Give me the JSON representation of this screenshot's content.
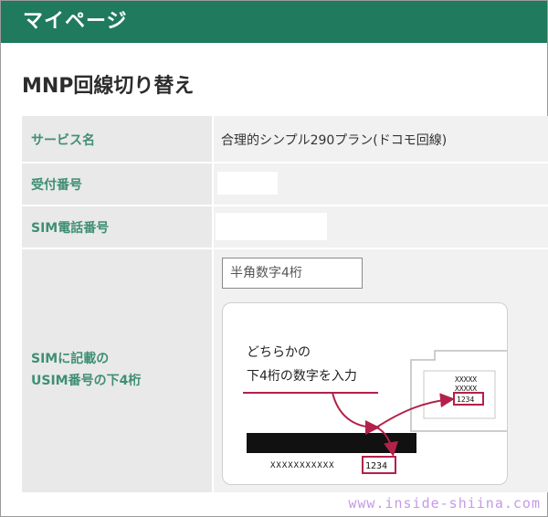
{
  "header": {
    "title": "マイページ"
  },
  "page": {
    "title": "MNP回線切り替え"
  },
  "rows": {
    "service": {
      "label": "サービス名",
      "value": "合理的シンプル290プラン(ドコモ回線)"
    },
    "receipt": {
      "label": "受付番号"
    },
    "sim_phone": {
      "label": "SIM電話番号"
    },
    "usim_digits": {
      "label_line1": "SIMに記載の",
      "label_line2": "USIM番号の下4桁",
      "placeholder": "半角数字4桁"
    }
  },
  "guide": {
    "caption_line1": "どちらかの",
    "caption_line2": "下4桁の数字を入力",
    "card_mask": "XXXXXXXXXXX",
    "card_digits": "1234",
    "sim_mask_1": "XXXXX",
    "sim_mask_2": "XXXXX",
    "sim_digits": "1234"
  },
  "watermark": "www.inside-shiina.com",
  "colors": {
    "header": "#1f7a5e",
    "label_text": "#3f8f74",
    "highlight": "#b3214a"
  }
}
